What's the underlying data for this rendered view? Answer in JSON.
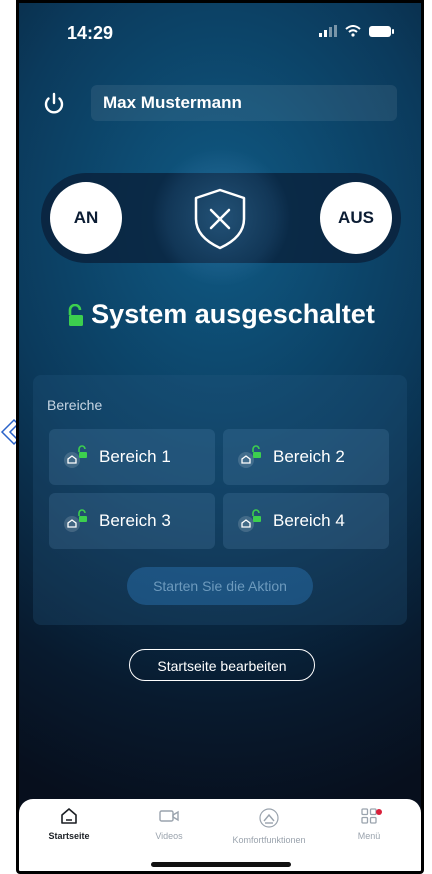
{
  "status_bar": {
    "time": "14:29"
  },
  "header": {
    "user_name": "Max Mustermann"
  },
  "arm_control": {
    "on_label": "AN",
    "off_label": "AUS"
  },
  "system": {
    "status_text": "System ausgeschaltet",
    "lock_color": "#3ccf4e"
  },
  "areas": {
    "title": "Bereiche",
    "items": [
      {
        "label": "Bereich 1"
      },
      {
        "label": "Bereich 2"
      },
      {
        "label": "Bereich 3"
      },
      {
        "label": "Bereich 4"
      }
    ],
    "action_label": "Starten Sie die Aktion"
  },
  "edit_home_label": "Startseite bearbeiten",
  "tabbar": {
    "tabs": [
      {
        "label": "Startseite",
        "icon": "home-icon",
        "active": true
      },
      {
        "label": "Videos",
        "icon": "video-icon",
        "active": false
      },
      {
        "label": "Komfortfunktionen",
        "icon": "comfort-icon",
        "active": false
      },
      {
        "label": "Menü",
        "icon": "grid-menu-icon",
        "active": false
      }
    ],
    "badge_color": "#d91f3a"
  },
  "colors": {
    "accent": "#0b3a5c",
    "background_dark": "#081a2e"
  }
}
